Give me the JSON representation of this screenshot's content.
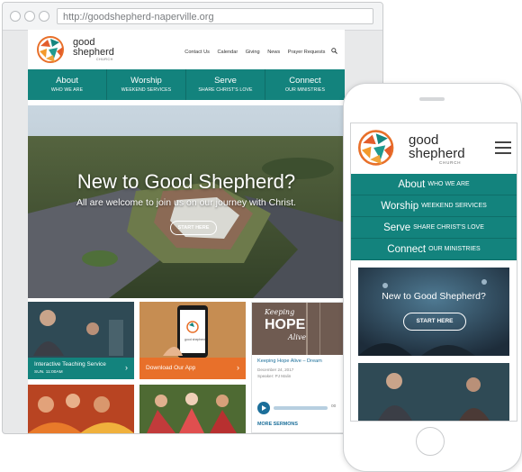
{
  "browser": {
    "url": "http://goodshepherd-naperville.org"
  },
  "brand": {
    "line1": "good",
    "line2": "shepherd",
    "line3": "CHURCH"
  },
  "top_links": [
    "Contact Us",
    "Calendar",
    "Giving",
    "News",
    "Prayer Requests"
  ],
  "nav": [
    {
      "title": "About",
      "sub": "WHO WE ARE"
    },
    {
      "title": "Worship",
      "sub": "WEEKEND SERVICES"
    },
    {
      "title": "Serve",
      "sub": "SHARE CHRIST'S LOVE"
    },
    {
      "title": "Connect",
      "sub": "OUR MINISTRIES"
    }
  ],
  "hero": {
    "title": "New to Good Shepherd?",
    "subtitle": "All are welcome to join us on our journey with Christ.",
    "button": "START HERE"
  },
  "cards": {
    "teaching": {
      "title": "Interactive Teaching Service",
      "sub": "SUN. 11:00AM"
    },
    "app": {
      "title": "Download Our App",
      "phone_brand": "good shepherd"
    },
    "sermon": {
      "art_top": "Keeping",
      "art_mid": "HOPE",
      "art_bottom": "Alive",
      "title": "Keeping Hope Alive – Dream",
      "date": "December 24, 2017",
      "speaker": "Speaker: PJ Malin",
      "time": "00",
      "more": "MORE SERMONS"
    }
  },
  "mobile": {
    "nav": [
      {
        "title": "About",
        "sub": "WHO WE ARE"
      },
      {
        "title": "Worship",
        "sub": "WEEKEND SERVICES"
      },
      {
        "title": "Serve",
        "sub": "SHARE CHRIST'S LOVE"
      },
      {
        "title": "Connect",
        "sub": "OUR MINISTRIES"
      }
    ],
    "hero_title": "New to Good Shepherd?",
    "hero_button": "START HERE"
  },
  "colors": {
    "teal": "#13837d",
    "orange": "#e8702a"
  },
  "icons": [
    "search-icon",
    "chevron-right-icon",
    "hamburger-menu-icon",
    "play-icon"
  ]
}
